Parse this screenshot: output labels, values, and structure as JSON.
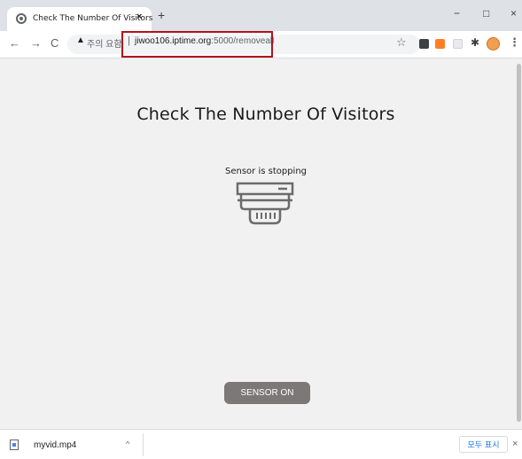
{
  "browser": {
    "tab_title": "Check The Number Of Visitors",
    "tab_close": "×",
    "new_tab": "+",
    "window_minimize": "−",
    "window_maximize": "□",
    "window_close": "×",
    "back": "←",
    "forward": "→",
    "reload": "C",
    "security_icon": "▲",
    "security_text": "주의 요함",
    "url_separator": "|",
    "url_host": "jiwoo106.iptime.org",
    "url_path": ":5000/removeall",
    "bookmark_star": "☆",
    "extensions_icon": "✱",
    "menu": "⋮"
  },
  "page": {
    "heading": "Check The Number Of Visitors",
    "status_text": "Sensor is stopping",
    "button_label": "SENSOR ON",
    "icon": "smoke-sensor-icon"
  },
  "download_shelf": {
    "file_name": "myvid.mp4",
    "chevron": "^",
    "show_all_label": "모두 표시",
    "close": "×"
  }
}
